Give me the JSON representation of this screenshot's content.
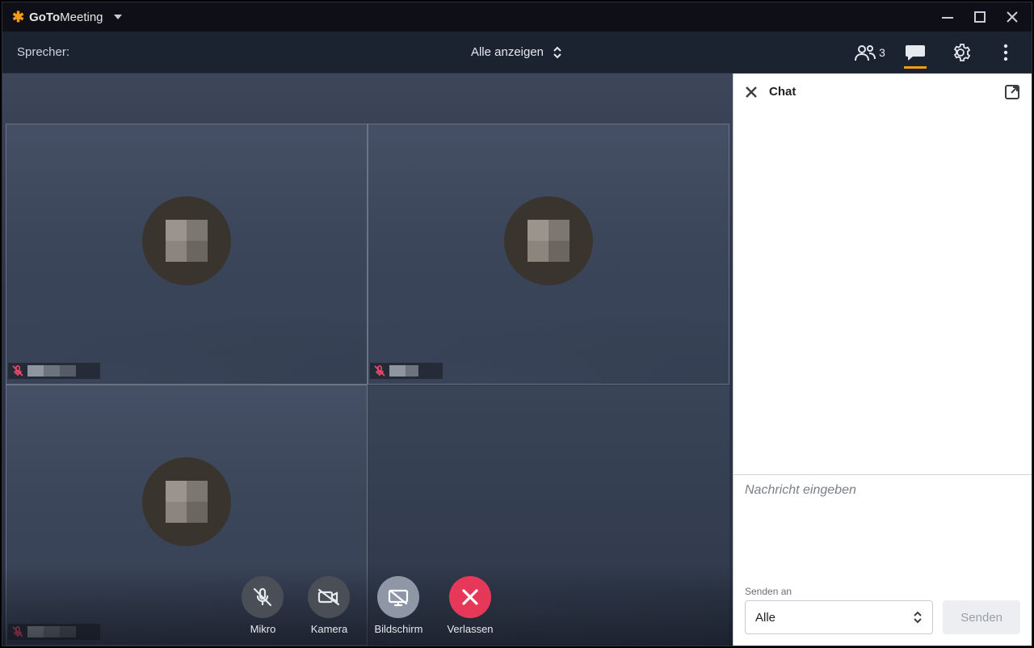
{
  "app": {
    "brand_prefix": "GoTo",
    "brand_suffix": "Meeting"
  },
  "toolbar": {
    "speaker_label": "Sprecher:",
    "view_mode": "Alle anzeigen",
    "participant_count": "3"
  },
  "chat": {
    "title": "Chat",
    "input_placeholder": "Nachricht eingeben",
    "send_to_label": "Senden an",
    "send_to_value": "Alle",
    "send_button": "Senden"
  },
  "controls": {
    "mic": "Mikro",
    "camera": "Kamera",
    "screen": "Bildschirm",
    "leave": "Verlassen"
  },
  "tiles": [
    {
      "muted": true
    },
    {
      "muted": true
    },
    {
      "muted": true
    }
  ]
}
